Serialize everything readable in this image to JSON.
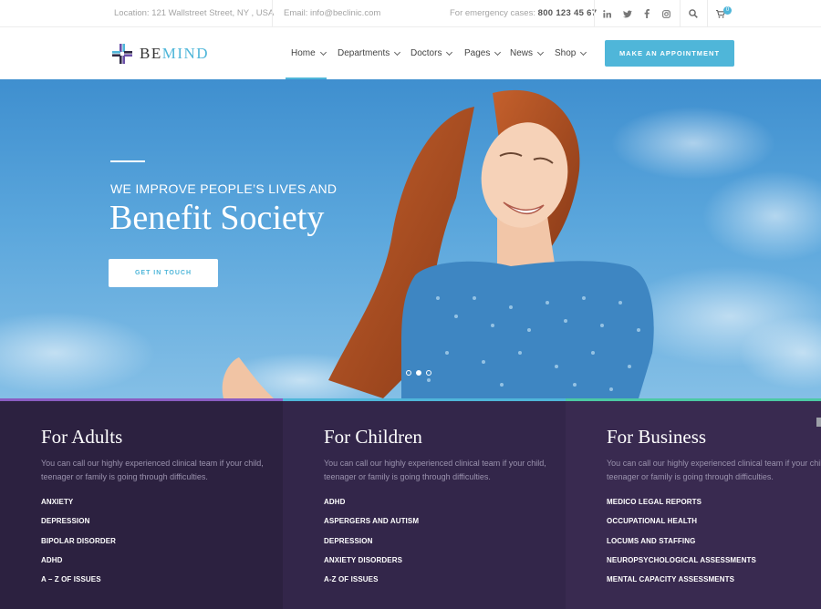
{
  "topbar": {
    "location": "Location: 121 Wallstreet Street, NY , USA",
    "email": "Email: info@beclinic.com",
    "emergency_label": "For emergency cases:",
    "emergency_phone": "800 123 45 67",
    "social_icons": [
      "linkedin-icon",
      "twitter-icon",
      "facebook-icon",
      "instagram-icon"
    ],
    "cart_count": "0"
  },
  "brand": {
    "name_part1": "BE",
    "name_part2": "MIND",
    "accent_color": "#4fb6d9"
  },
  "nav": {
    "items": [
      "Home",
      "Departments",
      "Doctors",
      "Pages",
      "News",
      "Shop"
    ],
    "active": "Home",
    "cta": "MAKE AN APPOINTMENT"
  },
  "hero": {
    "subtitle": "WE IMPROVE  PEOPLE’S LIVES AND",
    "title": "Benefit Society",
    "button": "GET IN TOUCH",
    "slides": 3,
    "active_slide": 2
  },
  "services": [
    {
      "title": "For Adults",
      "description": "You can call our highly experienced clinical team if your child, teenager or family is going through difficulties.",
      "items": [
        "ANXIETY",
        "DEPRESSION",
        "BIPOLAR DISORDER",
        "ADHD",
        "A – Z OF ISSUES"
      ],
      "accent": "#8a5cc2"
    },
    {
      "title": "For Children",
      "description": "You can call our highly experienced clinical team if your child, teenager or family is going through difficulties.",
      "items": [
        "ADHD",
        "ASPERGERS AND AUTISM",
        "DEPRESSION",
        "ANXIETY DISORDERS",
        "A-Z OF ISSUES"
      ],
      "accent": "#4fb6d9"
    },
    {
      "title": "For Business",
      "description": "You can call our highly experienced clinical team if your child, teenager or family is going through difficulties.",
      "items": [
        "MEDICO LEGAL REPORTS",
        "OCCUPATIONAL HEALTH",
        "LOCUMS AND STAFFING",
        "NEUROPSYCHOLOGICAL ASSESSMENTS",
        "MENTAL CAPACITY ASSESSMENTS"
      ],
      "accent": "#4cc9a4"
    }
  ]
}
